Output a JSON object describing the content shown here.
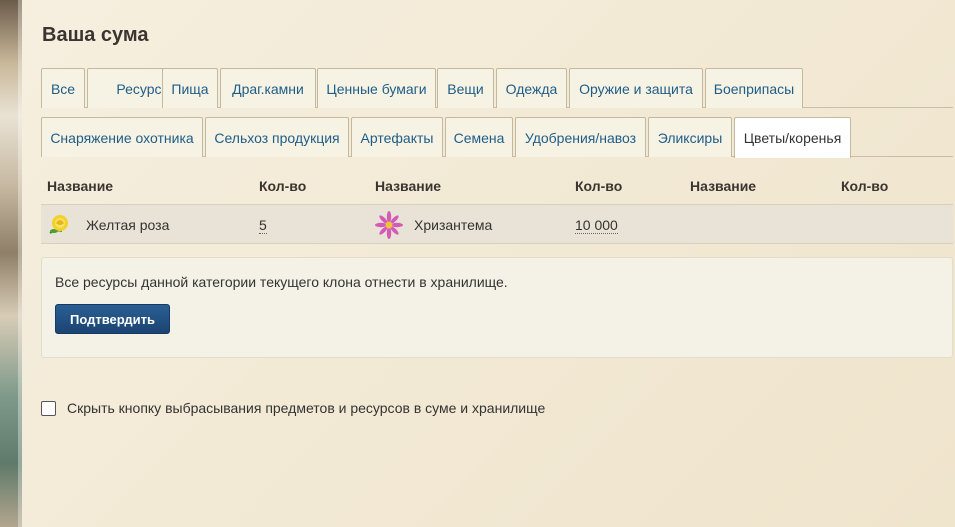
{
  "page": {
    "title": "Ваша сума"
  },
  "tabs_row1": [
    {
      "label": "Все"
    },
    {
      "label": "Ресурсы"
    },
    {
      "label": "Пища"
    },
    {
      "label": "Драг.камни"
    },
    {
      "label": "Ценные бумаги"
    },
    {
      "label": "Вещи"
    },
    {
      "label": "Одежда"
    },
    {
      "label": "Оружие и защита"
    },
    {
      "label": "Боеприпасы"
    }
  ],
  "tabs_row2": [
    {
      "label": "Снаряжение охотника"
    },
    {
      "label": "Сельхоз продукция"
    },
    {
      "label": "Артефакты"
    },
    {
      "label": "Семена"
    },
    {
      "label": "Удобрения/навоз"
    },
    {
      "label": "Эликсиры"
    },
    {
      "label": "Цветы/коренья",
      "active": true
    }
  ],
  "table": {
    "headers": [
      "Название",
      "Кол-во",
      "Название",
      "Кол-во",
      "Название",
      "Кол-во"
    ],
    "items": [
      {
        "name": "Желтая роза",
        "qty": "5",
        "icon": "yellow-rose-icon"
      },
      {
        "name": "Хризантема",
        "qty": "10 000",
        "icon": "chrysanthemum-icon"
      }
    ]
  },
  "panel": {
    "text": "Все ресурсы данной категории текущего клона отнести в хранилище.",
    "button": "Подтвердить"
  },
  "option": {
    "label": "Скрыть кнопку выбрасывания предметов и ресурсов в суме и хранилище",
    "checked": false
  },
  "colors": {
    "tab_text": "#1f5d87",
    "button": "#1b4472",
    "row_bg": "#e8e3d6"
  }
}
